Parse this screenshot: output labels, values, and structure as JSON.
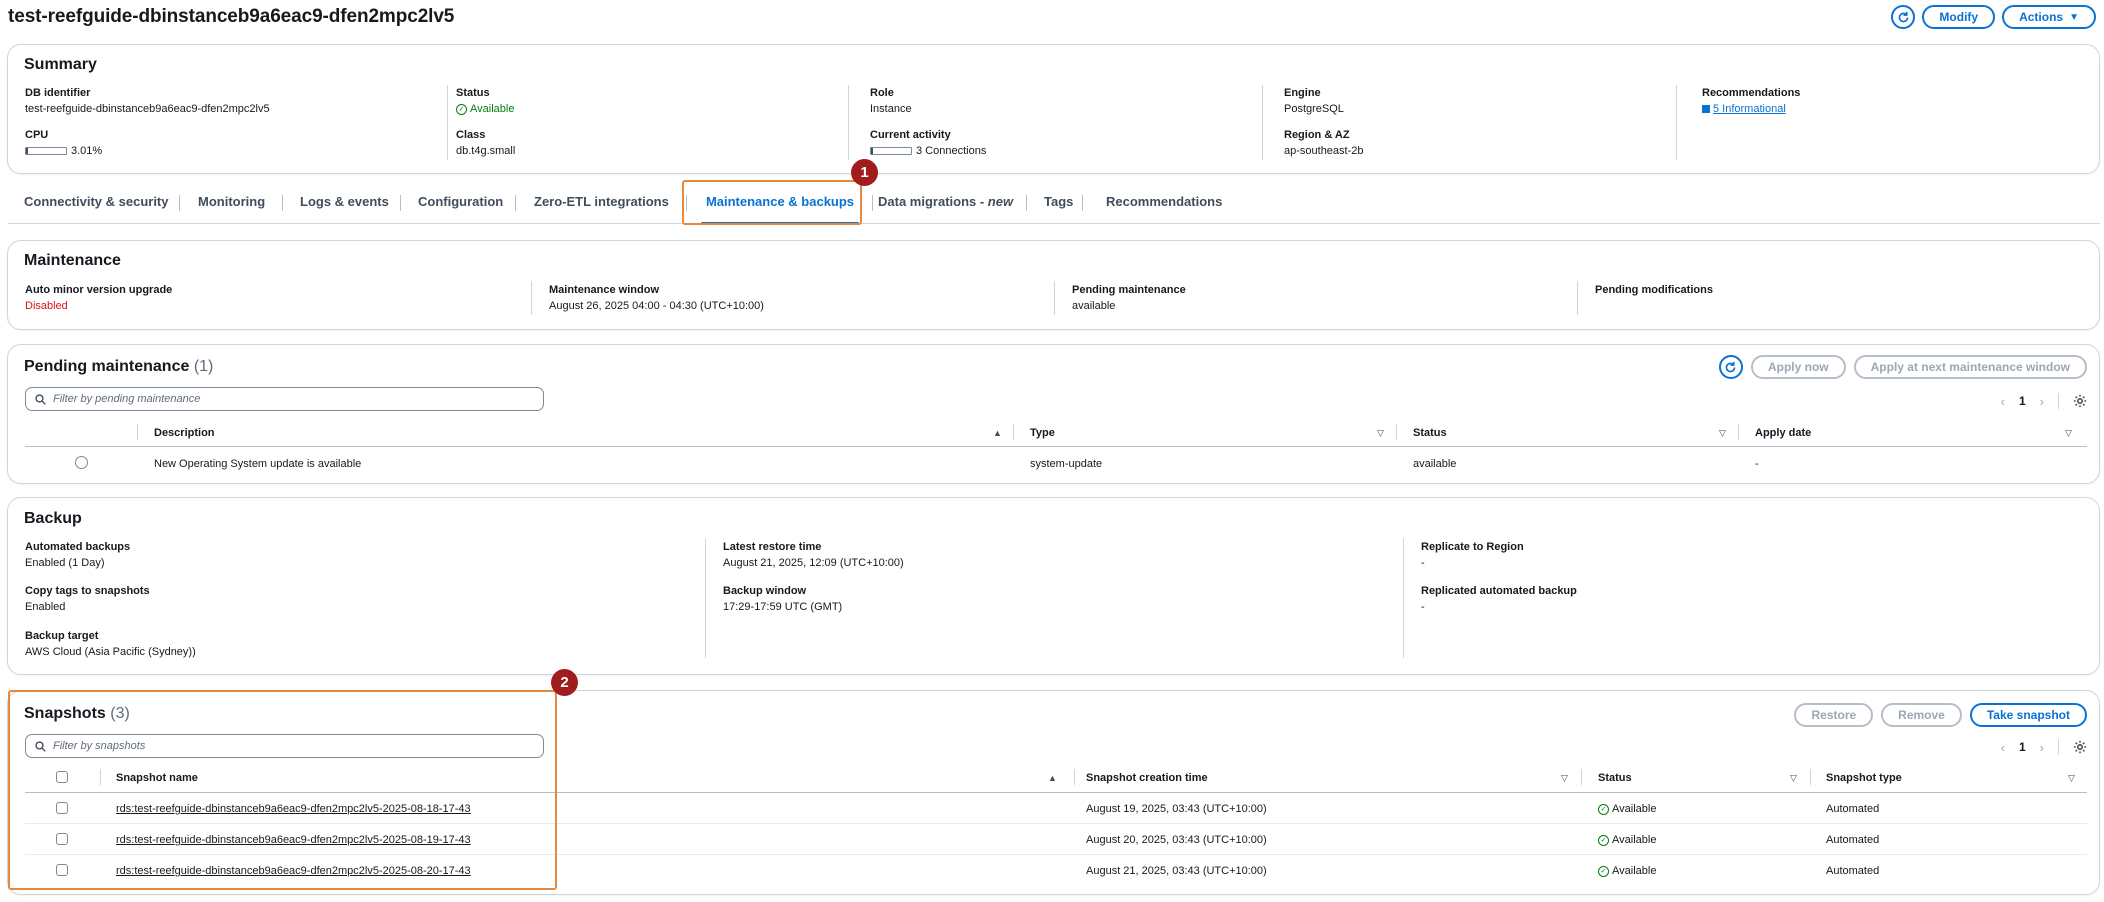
{
  "page": {
    "title": "test-reefguide-dbinstanceb9a6eac9-dfen2mpc2lv5",
    "modify_label": "Modify",
    "actions_label": "Actions"
  },
  "summary": {
    "title": "Summary",
    "db_identifier": {
      "label": "DB identifier",
      "value": "test-reefguide-dbinstanceb9a6eac9-dfen2mpc2lv5"
    },
    "cpu": {
      "label": "CPU",
      "value": "3.01%",
      "fraction": 0.0301
    },
    "status": {
      "label": "Status",
      "value": "Available"
    },
    "class": {
      "label": "Class",
      "value": "db.t4g.small"
    },
    "role": {
      "label": "Role",
      "value": "Instance"
    },
    "current_activity": {
      "label": "Current activity",
      "value": "3 Connections",
      "fraction": 0.03
    },
    "engine": {
      "label": "Engine",
      "value": "PostgreSQL"
    },
    "region": {
      "label": "Region & AZ",
      "value": "ap-southeast-2b"
    },
    "recommendations": {
      "label": "Recommendations",
      "value": "5 Informational"
    }
  },
  "tabs": [
    {
      "label": "Connectivity & security"
    },
    {
      "label": "Monitoring"
    },
    {
      "label": "Logs & events"
    },
    {
      "label": "Configuration"
    },
    {
      "label": "Zero-ETL integrations"
    },
    {
      "label": "Maintenance & backups"
    },
    {
      "label": "Data migrations - ",
      "suffix": "new"
    },
    {
      "label": "Tags"
    },
    {
      "label": "Recommendations"
    }
  ],
  "callouts": {
    "one": "1",
    "two": "2"
  },
  "maintenance": {
    "title": "Maintenance",
    "auto_minor": {
      "label": "Auto minor version upgrade",
      "value": "Disabled"
    },
    "window": {
      "label": "Maintenance window",
      "value": "August 26, 2025 04:00 - 04:30 (UTC+10:00)"
    },
    "pending": {
      "label": "Pending maintenance",
      "value": "available"
    },
    "modifications": {
      "label": "Pending modifications",
      "value": ""
    }
  },
  "pending_maintenance": {
    "title": "Pending maintenance",
    "count": "(1)",
    "apply_now_label": "Apply now",
    "apply_next_label": "Apply at next maintenance window",
    "filter_placeholder": "Filter by pending maintenance",
    "page": "1",
    "columns": [
      "Description",
      "Type",
      "Status",
      "Apply date"
    ],
    "rows": [
      {
        "description": "New Operating System update is available",
        "type": "system-update",
        "status": "available",
        "apply_date": "-"
      }
    ]
  },
  "backup": {
    "title": "Backup",
    "automated": {
      "label": "Automated backups",
      "value": "Enabled (1 Day)"
    },
    "copy_tags": {
      "label": "Copy tags to snapshots",
      "value": "Enabled"
    },
    "target": {
      "label": "Backup target",
      "value": "AWS Cloud (Asia Pacific (Sydney))"
    },
    "latest_restore": {
      "label": "Latest restore time",
      "value": "August 21, 2025, 12:09 (UTC+10:00)"
    },
    "window": {
      "label": "Backup window",
      "value": "17:29-17:59 UTC (GMT)"
    },
    "replicate": {
      "label": "Replicate to Region",
      "value": "-"
    },
    "replicated": {
      "label": "Replicated automated backup",
      "value": "-"
    }
  },
  "snapshots": {
    "title": "Snapshots",
    "count": "(3)",
    "restore_label": "Restore",
    "remove_label": "Remove",
    "take_label": "Take snapshot",
    "filter_placeholder": "Filter by snapshots",
    "page": "1",
    "columns": [
      "Snapshot name",
      "Snapshot creation time",
      "Status",
      "Snapshot type"
    ],
    "rows": [
      {
        "name": "rds:test-reefguide-dbinstanceb9a6eac9-dfen2mpc2lv5-2025-08-18-17-43",
        "time": "August 19, 2025, 03:43 (UTC+10:00)",
        "status": "Available",
        "type": "Automated"
      },
      {
        "name": "rds:test-reefguide-dbinstanceb9a6eac9-dfen2mpc2lv5-2025-08-19-17-43",
        "time": "August 20, 2025, 03:43 (UTC+10:00)",
        "status": "Available",
        "type": "Automated"
      },
      {
        "name": "rds:test-reefguide-dbinstanceb9a6eac9-dfen2mpc2lv5-2025-08-20-17-43",
        "time": "August 21, 2025, 03:43 (UTC+10:00)",
        "status": "Available",
        "type": "Automated"
      }
    ]
  }
}
